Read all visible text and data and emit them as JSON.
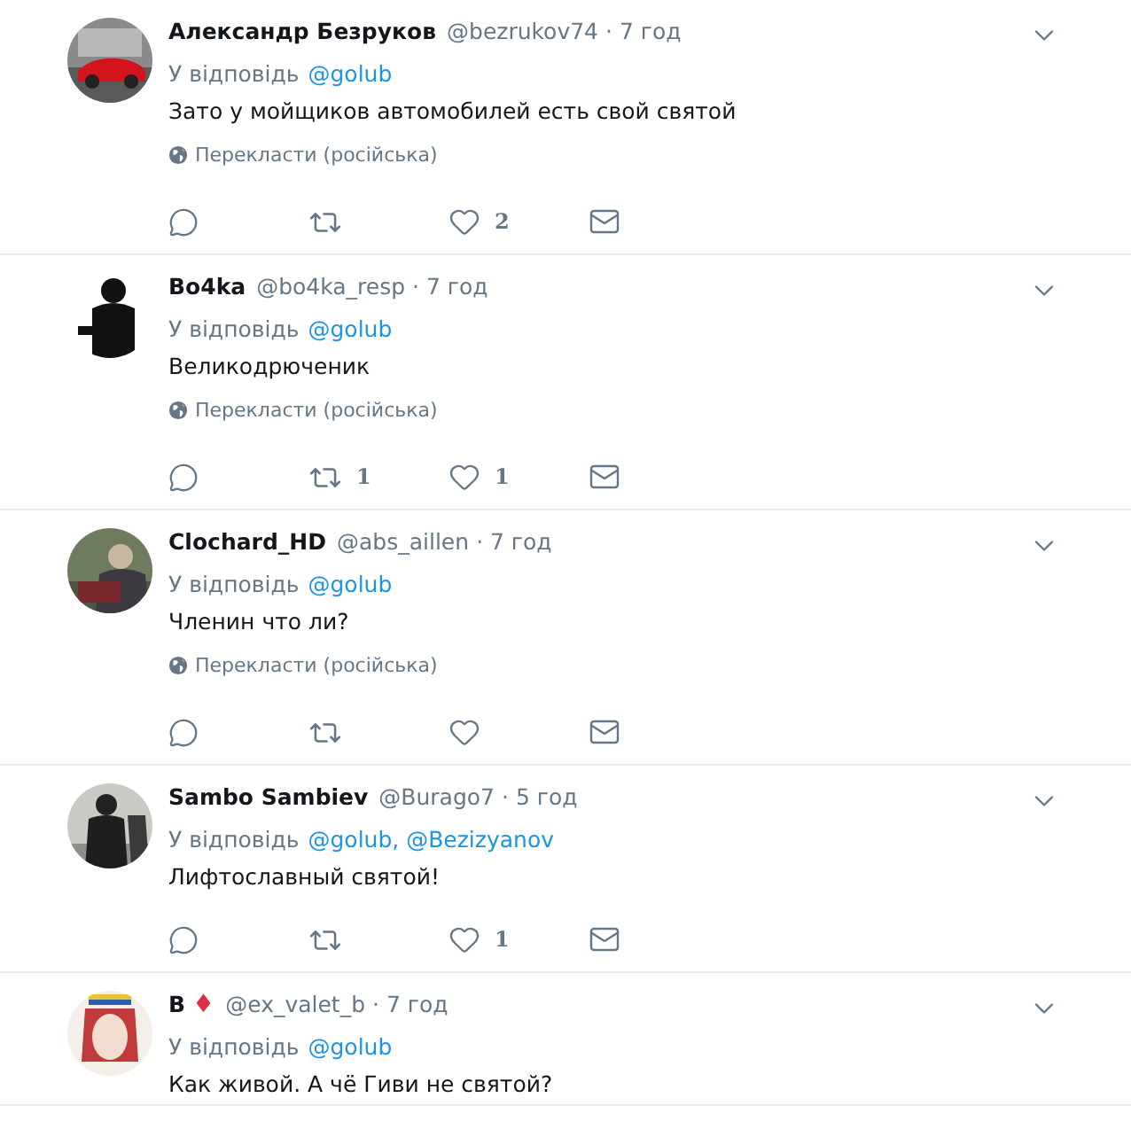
{
  "tweets": [
    {
      "name": "Александр Безруков",
      "handle": "@bezrukov74",
      "time": "· 7 год",
      "reply_label": "У відповідь",
      "mentions": "@golub",
      "text": "Зато у мойщиков автомобилей есть свой святой",
      "translate": "Перекласти (російська)",
      "likes": "2"
    },
    {
      "name": "Bo4ka",
      "handle": "@bo4ka_resp",
      "time": "· 7 год",
      "reply_label": "У відповідь",
      "mentions": "@golub",
      "text": "Великодрюченик",
      "translate": "Перекласти (російська)",
      "retweets": "1",
      "likes": "1"
    },
    {
      "name": "Clochard_HD",
      "handle": "@abs_aillen",
      "time": "· 7 год",
      "reply_label": "У відповідь",
      "mentions": "@golub",
      "text": "Членин что ли?",
      "translate": "Перекласти (російська)"
    },
    {
      "name": "Sambo Sambiev",
      "handle": "@Burago7",
      "time": "· 5 год",
      "reply_label": "У відповідь",
      "mentions": "@golub, @Bezizyanov",
      "text": "Лифтославный святой!",
      "likes": "1"
    },
    {
      "name": "B",
      "name_emoji": "♦",
      "handle": "@ex_valet_b",
      "time": "· 7 год",
      "reply_label": "У відповідь",
      "mentions": "@golub",
      "text": "Как живой. А чё Гиви не святой?"
    }
  ]
}
